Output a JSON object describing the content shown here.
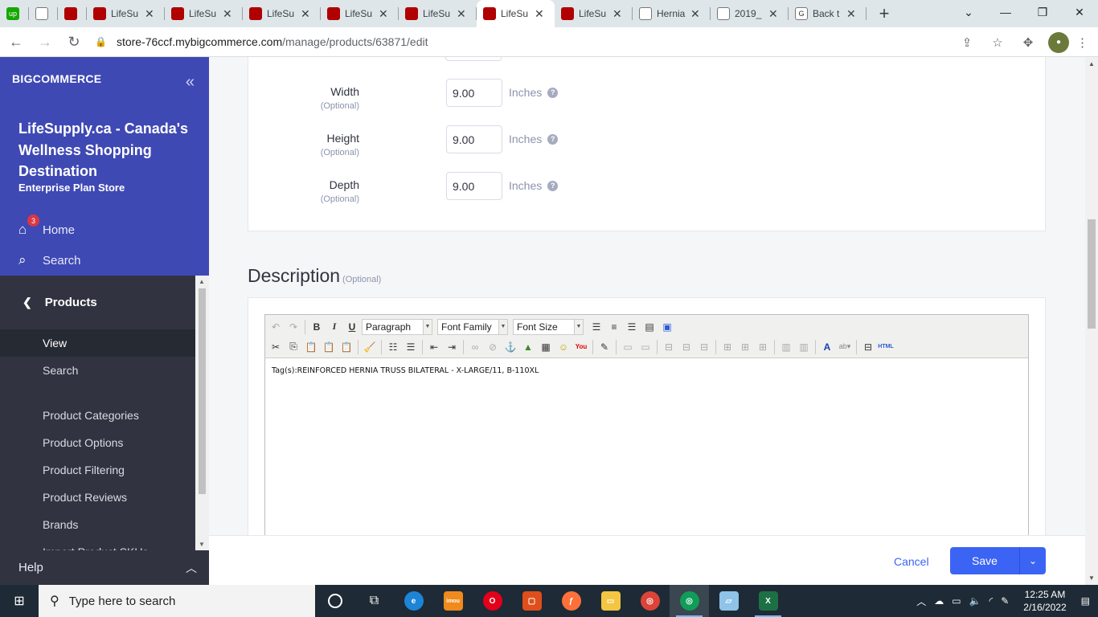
{
  "browser": {
    "tabs": [
      {
        "title": "",
        "favicon": "upwork-icon",
        "color": "#14a800",
        "label": "up",
        "close": false
      },
      {
        "title": "",
        "favicon": "doc-icon",
        "color": "#ffffff",
        "label": "",
        "close": false
      },
      {
        "title": "",
        "favicon": "lifesupply-icon",
        "color": "#b00000",
        "label": "",
        "close": false
      },
      {
        "title": "LifeSu",
        "favicon": "lifesupply-icon",
        "color": "#b00000",
        "label": "",
        "close": true
      },
      {
        "title": "LifeSu",
        "favicon": "lifesupply-icon",
        "color": "#b00000",
        "label": "",
        "close": true
      },
      {
        "title": "LifeSu",
        "favicon": "lifesupply-icon",
        "color": "#b00000",
        "label": "",
        "close": true
      },
      {
        "title": "LifeSu",
        "favicon": "lifesupply-icon",
        "color": "#b00000",
        "label": "",
        "close": true
      },
      {
        "title": "LifeSu",
        "favicon": "lifesupply-icon",
        "color": "#b00000",
        "label": "",
        "close": true
      },
      {
        "title": "LifeSu",
        "favicon": "lifesupply-icon",
        "color": "#b00000",
        "label": "",
        "close": true,
        "active": true
      },
      {
        "title": "LifeSu",
        "favicon": "lifesupply-icon",
        "color": "#b00000",
        "label": "",
        "close": true
      },
      {
        "title": "Hernia",
        "favicon": "doc-icon",
        "color": "#ffffff",
        "label": "",
        "close": true
      },
      {
        "title": "2019_",
        "favicon": "doc-icon",
        "color": "#ffffff",
        "label": "",
        "close": true
      },
      {
        "title": "Back t",
        "favicon": "google-icon",
        "color": "#ffffff",
        "label": "G",
        "close": true
      }
    ],
    "url_host": "store-76ccf.mybigcommerce.com",
    "url_path": "/manage/products/63871/edit"
  },
  "sidebar": {
    "logo_text": "BIGCOMMERCE",
    "store_name": "LifeSupply.ca - Canada's Wellness Shopping Destination",
    "plan": "Enterprise Plan Store",
    "home_label": "Home",
    "home_badge": "3",
    "search_label": "Search",
    "section": "Products",
    "sub_items": [
      {
        "label": "View",
        "active": true
      },
      {
        "label": "Search",
        "active": false
      }
    ],
    "sub_items_2": [
      {
        "label": "Product Categories"
      },
      {
        "label": "Product Options"
      },
      {
        "label": "Product Filtering"
      },
      {
        "label": "Product Reviews"
      },
      {
        "label": "Brands"
      },
      {
        "label": "Import Product SKUs"
      }
    ],
    "help_label": "Help"
  },
  "dimensions": [
    {
      "label": "Width",
      "optional": "(Optional)",
      "value": "9.00",
      "unit": "Inches"
    },
    {
      "label": "Height",
      "optional": "(Optional)",
      "value": "9.00",
      "unit": "Inches"
    },
    {
      "label": "Depth",
      "optional": "(Optional)",
      "value": "9.00",
      "unit": "Inches"
    }
  ],
  "description": {
    "title": "Description",
    "optional": "(Optional)",
    "paragraph_select": "Paragraph",
    "font_family_select": "Font Family",
    "font_size_select": "Font Size",
    "content": "Tag(s):REINFORCED HERNIA TRUSS BILATERAL - X-LARGE/11, B-110XL"
  },
  "footer": {
    "cancel_label": "Cancel",
    "save_label": "Save"
  },
  "taskbar": {
    "search_placeholder": "Type here to search",
    "time": "12:25 AM",
    "date": "2/16/2022"
  }
}
